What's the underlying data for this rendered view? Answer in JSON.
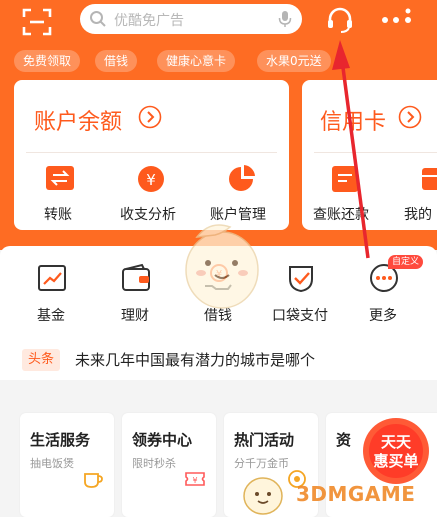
{
  "header": {
    "search_placeholder": "优酷免广告",
    "chips": [
      "免费领取",
      "借钱",
      "健康心意卡",
      "水果0元送"
    ]
  },
  "cards": [
    {
      "title": "账户余额",
      "actions": [
        {
          "label": "转账",
          "icon": "transfer-icon"
        },
        {
          "label": "收支分析",
          "icon": "yen-coin-icon"
        },
        {
          "label": "账户管理",
          "icon": "pie-chart-icon"
        }
      ]
    },
    {
      "title": "信用卡",
      "actions": [
        {
          "label": "查账还款",
          "icon": "bill-icon"
        },
        {
          "label": "我的",
          "icon": "card-icon"
        }
      ]
    }
  ],
  "grid": [
    {
      "label": "基金",
      "icon": "fund-chart-icon"
    },
    {
      "label": "理财",
      "icon": "wallet-icon"
    },
    {
      "label": "借钱",
      "icon": "hand-coin-icon"
    },
    {
      "label": "口袋支付",
      "icon": "pocket-pay-icon"
    },
    {
      "label": "更多",
      "icon": "more-dots-icon"
    }
  ],
  "custom_badge": "自定义",
  "news": {
    "tag": "头条",
    "text": "未来几年中国最有潜力的城市是哪个"
  },
  "services": [
    {
      "title": "生活服务",
      "subtitle": "抽电饭煲",
      "icon": "cup-icon"
    },
    {
      "title": "领券中心",
      "subtitle": "限时秒杀",
      "icon": "ticket-icon"
    },
    {
      "title": "热门活动",
      "subtitle": "分千万金币",
      "icon": "coin-icon"
    },
    {
      "title": "资",
      "subtitle": "",
      "icon": ""
    }
  ],
  "promo": {
    "line1": "天天",
    "line2": "惠买单"
  },
  "watermark": "3DMGAME",
  "colors": {
    "brand": "#fe6c23",
    "accent": "#fe5a1d",
    "arrow": "#e8262e"
  }
}
